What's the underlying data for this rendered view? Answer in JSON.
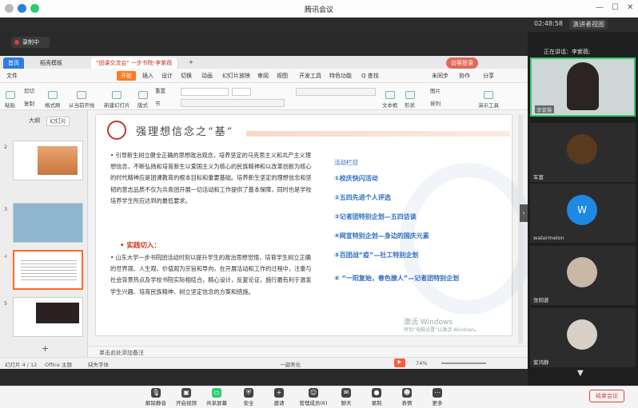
{
  "window": {
    "title": "腾讯会议",
    "time": "02:48:58",
    "view_mode": "演讲者视图"
  },
  "recording": {
    "label": "录制中"
  },
  "wps": {
    "tabs": [
      "首页",
      "稻壳模板",
      "\"团课交流会\" 一步书院-李紫薇"
    ],
    "share_badge": "访客登录",
    "menus": [
      "文件",
      "开始",
      "插入",
      "设计",
      "切换",
      "动画",
      "幻灯片放映",
      "审阅",
      "视图",
      "开发工具",
      "特色功能",
      "Q 查找"
    ],
    "menus_right": [
      "未同步",
      "协作",
      "分享"
    ],
    "ribbon_left": [
      "粘贴",
      "剪切",
      "复制",
      "格式刷",
      "从当前开始",
      "新建幻灯片",
      "版式",
      "节",
      "重置"
    ],
    "ribbon_right": [
      "文本框",
      "形状",
      "图片",
      "排列",
      "演示工具"
    ],
    "panel_tabs": [
      "大纲",
      "幻灯片"
    ],
    "thumb_numbers": [
      "2",
      "3",
      "4",
      "5"
    ],
    "notes_placeholder": "单击此处添加备注",
    "status": {
      "slide": "幻灯片 4 / 12",
      "theme": "Office 主题",
      "font": "缺失字体",
      "beautify": "一键美化",
      "zoom": "74%"
    }
  },
  "slide": {
    "title": "强理想信念之“基”",
    "para1": "•  引导新生树立健全正确的思想政治观念，培养坚定的马克思主义和共产主义理想信念，不断弘扬和培育新生以爱国主义为核心的民族精神和以改革创新为核心的时代精神应是团课教育的根本目标和重要基础。培养新生坚定的理想信念和坚韧的意志品质不仅为共青团开展一切活动和工作提供了基本保障，同时也是学校培养学生所应达到的最低要求。",
    "section_label": "•  实践切入：",
    "para2": "•  山东大学一步书院团活动时刻以提升学生的政治思想觉悟，培育学生树立正确的世界观、人生观、价值观为宗旨和导向，在开展活动和工作的过程中，注重与社会背景热点及学校书院实际相结合，精心设计，反复论证，施行最有利于激发学生兴趣、培育民族精神、树立坚定信念的方案和措施。",
    "activities_title": "活动栏目",
    "activities": [
      "①校庆快闪活动",
      "②五四先进个人评选",
      "③记者团特别企划—五四访谈",
      "④网宣特别企划—身边的国庆元素",
      "⑤百团战“疫”—社工特别企划",
      "⑥  “一阳复始，春色撩人”—记者团特别企划"
    ],
    "activate_windows": "激活 Windows",
    "activate_windows_sub": "转到“电脑设置”以激活 Windows。"
  },
  "participants": {
    "speaking": "正在讲话：李紫薇;",
    "list": [
      {
        "name": "李紫薇",
        "avatar_letter": ""
      },
      {
        "name": "军富",
        "avatar_letter": ""
      },
      {
        "name": "watermelon",
        "avatar_letter": "W"
      },
      {
        "name": "张刚菱",
        "avatar_letter": ""
      },
      {
        "name": "紫鸿静",
        "avatar_letter": ""
      }
    ]
  },
  "toolbar": {
    "buttons": [
      "解除静音",
      "开启视频",
      "共享屏幕",
      "安全",
      "邀请",
      "管理成员(6)",
      "聊天",
      "录制",
      "表情",
      "更多"
    ],
    "end_label": "结束会议"
  },
  "colors": {
    "accent": "#ff7a1a",
    "blue": "#2f6fc2",
    "red": "#d0341f",
    "green": "#2ecc71",
    "end": "#e04040"
  }
}
